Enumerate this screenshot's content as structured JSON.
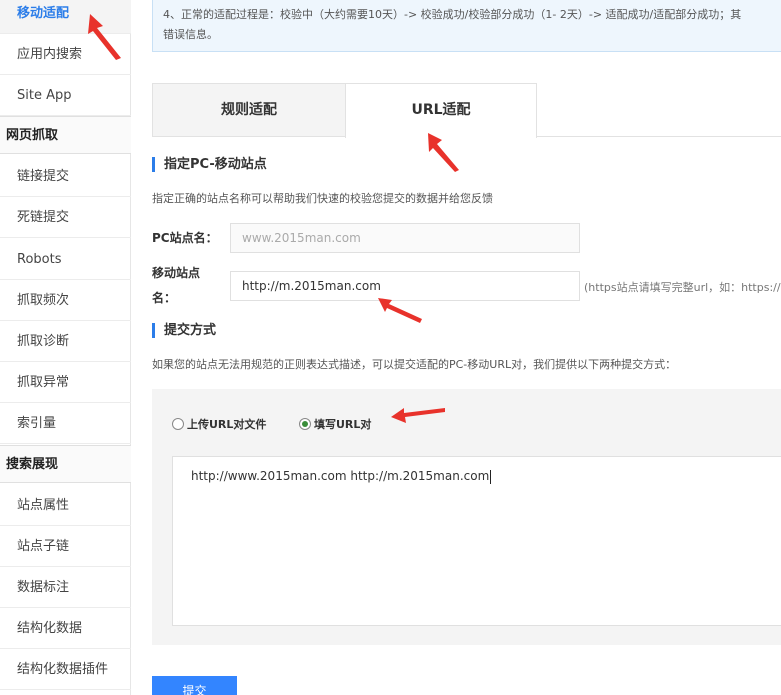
{
  "sidebar": {
    "active_item": "移动适配",
    "items_group1": [
      "应用内搜索",
      "Site App"
    ],
    "group2_header": "网页抓取",
    "items_group2": [
      "链接提交",
      "死链提交",
      "Robots",
      "抓取频次",
      "抓取诊断",
      "抓取异常",
      "索引量"
    ],
    "group3_header": "搜索展现",
    "items_group3": [
      "站点属性",
      "站点子链",
      "数据标注",
      "结构化数据",
      "结构化数据插件"
    ]
  },
  "notice": {
    "line1": "4、正常的适配过程是：校验中（大约需要10天）-> 校验成功/校验部分成功（1- 2天）-> 适配成功/适配部分成功；其",
    "line2": "错误信息。"
  },
  "tabs": [
    "规则适配",
    "URL适配"
  ],
  "section_pc": {
    "title": "指定PC-移动站点",
    "desc": "指定正确的站点名称可以帮助我们快速的校验您提交的数据并给您反馈"
  },
  "form": {
    "pc_label": "PC站点名：",
    "pc_value": "www.2015man.com",
    "mobile_label_line1": "移动站点",
    "mobile_label_line2": "名：",
    "mobile_value": "http://m.2015man.com",
    "mobile_hint": "(https站点请填写完整url，如：https://"
  },
  "section_submit": {
    "title": "提交方式",
    "desc": "如果您的站点无法用规范的正则表达式描述，可以提交适配的PC-移动URL对，我们提供以下两种提交方式："
  },
  "radios": [
    {
      "label": "上传URL对文件",
      "checked": false
    },
    {
      "label": "填写URL对",
      "checked": true
    }
  ],
  "textarea_value": "http://www.2015man.com http://m.2015man.com",
  "submit_label": "提交",
  "colors": {
    "accent": "#2b7de9",
    "button": "#3385ff",
    "arrow": "#e8322b"
  }
}
